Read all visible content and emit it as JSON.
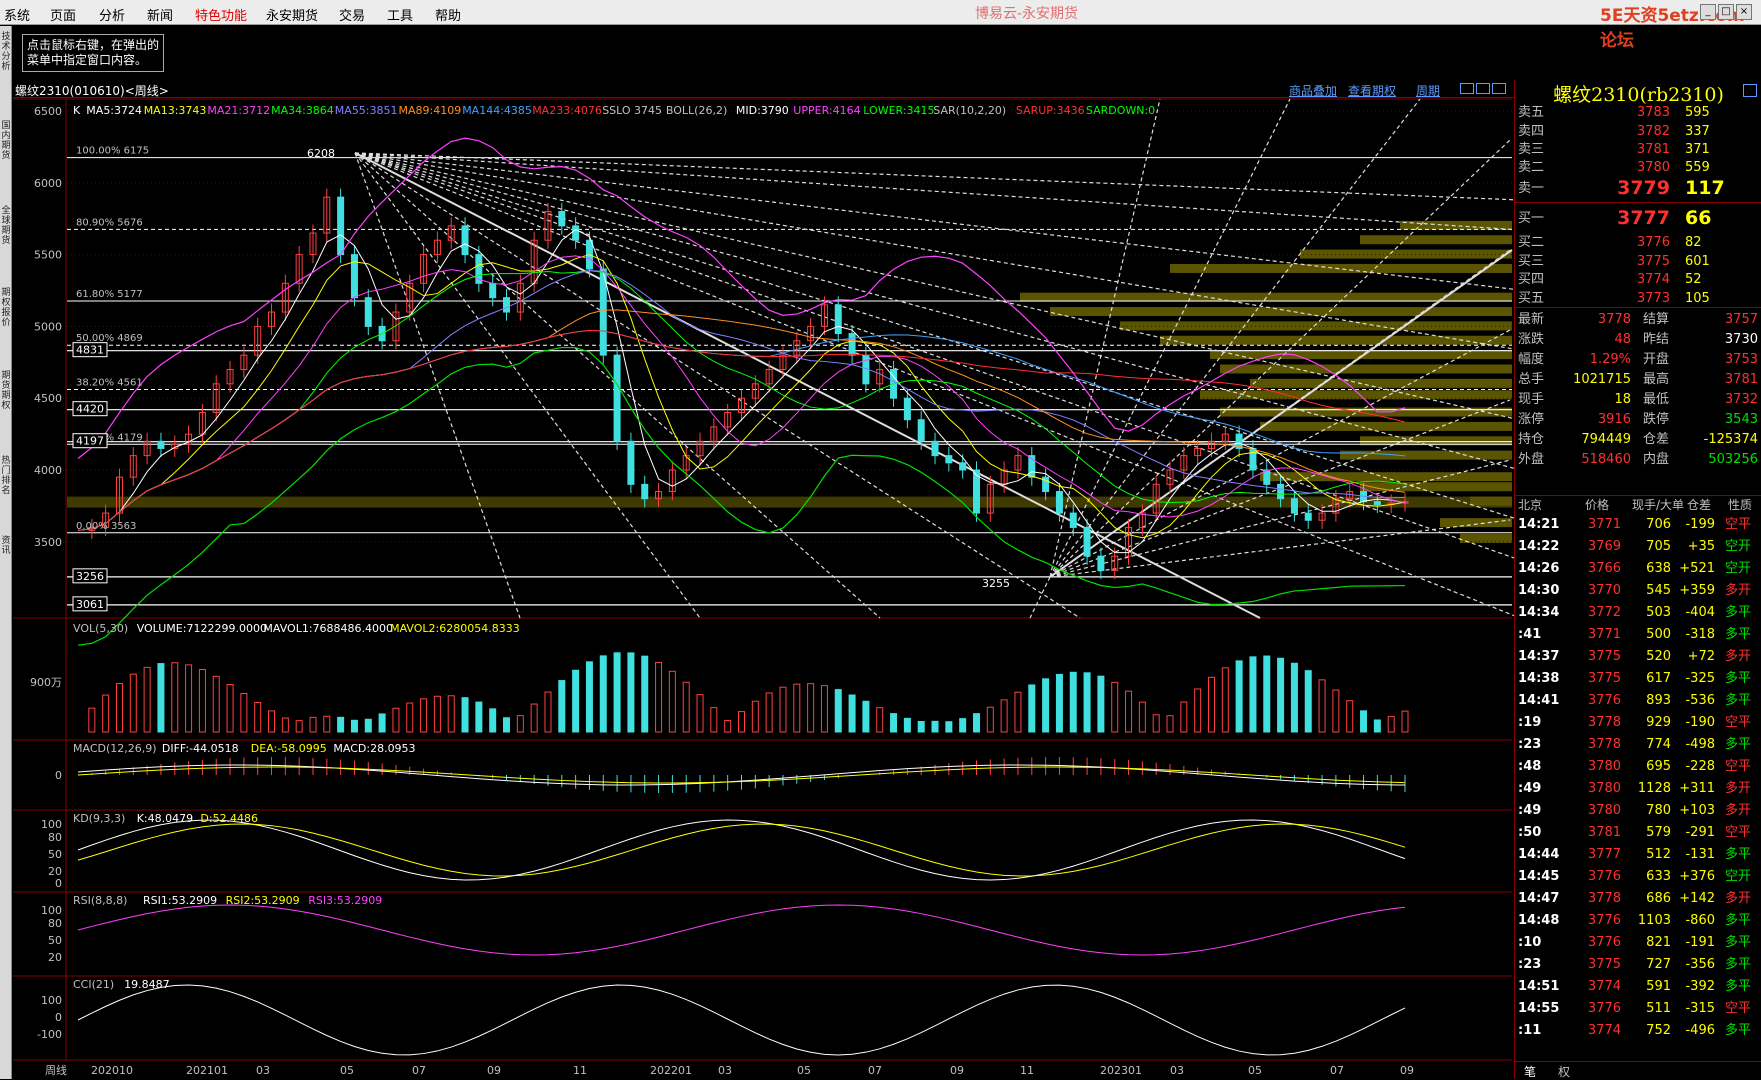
{
  "menu": {
    "items": [
      "系统",
      "页面",
      "分析",
      "新闻",
      "特色功能",
      "永安期货",
      "交易",
      "工具",
      "帮助"
    ],
    "highlight_index": 4,
    "app_title": "博易云-永安期货",
    "watermark": "5E天资5etz.com论坛",
    "window_buttons": [
      "_",
      "□",
      "×"
    ]
  },
  "left_sidebar_tabs": [
    "技术分析",
    "国内期货",
    "全球期货",
    "期权报价",
    "期货期权",
    "热门排名",
    "资讯"
  ],
  "tooltip": {
    "line1": "点击鼠标右键，在弹出的",
    "line2": "菜单中指定窗口内容。"
  },
  "symbol_bar": {
    "title": "螺纹2310(010610)<周线>",
    "link1": "商品叠加",
    "link2": "查看期权",
    "link3": "周期"
  },
  "main_header": [
    {
      "t": "K",
      "c": "#ffffff"
    },
    {
      "t": "MA5:3724",
      "c": "#ffffff"
    },
    {
      "t": "MA13:3743",
      "c": "#ffff00"
    },
    {
      "t": "MA21:3712",
      "c": "#ff40ff"
    },
    {
      "t": "MA34:3864",
      "c": "#00ff00"
    },
    {
      "t": "MA55:3851",
      "c": "#8080ff"
    },
    {
      "t": "MA89:4109",
      "c": "#ff9020"
    },
    {
      "t": "MA144:4385",
      "c": "#40a0ff"
    },
    {
      "t": "MA233:4076",
      "c": "#ff3030"
    },
    {
      "t": "SSLO 3745",
      "c": "#c0c0c0"
    },
    {
      "t": "BOLL(26,2)",
      "c": "#c0c0c0"
    },
    {
      "t": "MID:3790",
      "c": "#ffffff"
    },
    {
      "t": "UPPER:4164",
      "c": "#ff40ff"
    },
    {
      "t": "LOWER:3415",
      "c": "#00ff00"
    },
    {
      "t": "SAR(10,2,20)",
      "c": "#c0c0c0"
    },
    {
      "t": "SARUP:3436",
      "c": "#ff3030"
    },
    {
      "t": "SARDOWN:0",
      "c": "#00ff00"
    }
  ],
  "price_axis": [
    "6500",
    "6000",
    "5500",
    "5000",
    "4500",
    "4000",
    "3500"
  ],
  "fib_labels": [
    "100.00% 6175",
    "80.90% 5676",
    "61.80% 5177",
    "50.00% 4869",
    "38.20% 4561",
    "23.60% 4179",
    "0.00% 3563"
  ],
  "box_levels": [
    "4831",
    "4420",
    "4197",
    "3256",
    "3061"
  ],
  "peak_label": "6208",
  "low_label": "3255",
  "vol_header": [
    {
      "t": "VOL(5,30)",
      "c": "#c0c0c0"
    },
    {
      "t": "VOLUME:7122299.0000",
      "c": "#ffffff"
    },
    {
      "t": "MAVOL1:7688486.4000",
      "c": "#ffffff"
    },
    {
      "t": "MAVOL2:6280054.8333",
      "c": "#ffff00"
    }
  ],
  "vol_axis": "900万",
  "macd_header": [
    {
      "t": "MACD(12,26,9)",
      "c": "#c0c0c0"
    },
    {
      "t": "DIFF:-44.0518",
      "c": "#ffffff"
    },
    {
      "t": "DEA:-58.0995",
      "c": "#ffff00"
    },
    {
      "t": "MACD:28.0953",
      "c": "#ffffff"
    }
  ],
  "macd_axis": "0",
  "kd_header": [
    {
      "t": "KD(9,3,3)",
      "c": "#c0c0c0"
    },
    {
      "t": "K:48.0479",
      "c": "#ffffff"
    },
    {
      "t": "D:52.4486",
      "c": "#ffff00"
    }
  ],
  "kd_axis": [
    "100",
    "80",
    "50",
    "20",
    "0"
  ],
  "rsi_header": [
    {
      "t": "RSI(8,8,8)",
      "c": "#c0c0c0"
    },
    {
      "t": "RSI1:53.2909",
      "c": "#ffffff"
    },
    {
      "t": "RSI2:53.2909",
      "c": "#ffff00"
    },
    {
      "t": "RSI3:53.2909",
      "c": "#ff40ff"
    }
  ],
  "rsi_axis": [
    "100",
    "80",
    "50",
    "20"
  ],
  "cci_header": [
    {
      "t": "CCI(21)",
      "c": "#c0c0c0"
    },
    {
      "t": "19.8487",
      "c": "#ffffff"
    }
  ],
  "cci_axis": [
    "100",
    "0",
    "-100"
  ],
  "x_axis": [
    "周线",
    "202010",
    "202101",
    "03",
    "05",
    "07",
    "09",
    "11",
    "202201",
    "03",
    "05",
    "07",
    "09",
    "11",
    "202301",
    "03",
    "05",
    "07",
    "09"
  ],
  "quote": {
    "title": "螺纹2310(rb2310)",
    "asks": [
      {
        "label": "卖五",
        "price": "3783",
        "vol": "595"
      },
      {
        "label": "卖四",
        "price": "3782",
        "vol": "337"
      },
      {
        "label": "卖三",
        "price": "3781",
        "vol": "371"
      },
      {
        "label": "卖二",
        "price": "3780",
        "vol": "559"
      },
      {
        "label": "卖一",
        "price": "3779",
        "vol": "117"
      }
    ],
    "bids": [
      {
        "label": "买一",
        "price": "3777",
        "vol": "66"
      },
      {
        "label": "买二",
        "price": "3776",
        "vol": "82"
      },
      {
        "label": "买三",
        "price": "3775",
        "vol": "601"
      },
      {
        "label": "买四",
        "price": "3774",
        "vol": "52"
      },
      {
        "label": "买五",
        "price": "3773",
        "vol": "105"
      }
    ],
    "stats": [
      {
        "l1": "最新",
        "v1": "3778",
        "c1": "red",
        "l2": "结算",
        "v2": "3757",
        "c2": "red"
      },
      {
        "l1": "涨跌",
        "v1": "48",
        "c1": "red",
        "l2": "昨结",
        "v2": "3730",
        "c2": "wht"
      },
      {
        "l1": "幅度",
        "v1": "1.29%",
        "c1": "red",
        "l2": "开盘",
        "v2": "3753",
        "c2": "red"
      },
      {
        "l1": "总手",
        "v1": "1021715",
        "c1": "yel",
        "l2": "最高",
        "v2": "3781",
        "c2": "red"
      },
      {
        "l1": "现手",
        "v1": "18",
        "c1": "yel",
        "l2": "最低",
        "v2": "3732",
        "c2": "red"
      },
      {
        "l1": "涨停",
        "v1": "3916",
        "c1": "red",
        "l2": "跌停",
        "v2": "3543",
        "c2": "grn"
      },
      {
        "l1": "持仓",
        "v1": "794449",
        "c1": "yel",
        "l2": "仓差",
        "v2": "-125374",
        "c2": "yel"
      },
      {
        "l1": "外盘",
        "v1": "518460",
        "c1": "red",
        "l2": "内盘",
        "v2": "503256",
        "c2": "grn"
      }
    ],
    "tick_header": {
      "c1": "北京",
      "c2": "价格",
      "c3": "现手/大单",
      "c4": "仓差",
      "c5": "性质"
    },
    "ticks": [
      {
        "t": "14:21",
        "p": "3771",
        "v": "706",
        "d": "-199",
        "n": "空平",
        "nc": "red"
      },
      {
        "t": "14:22",
        "p": "3769",
        "v": "705",
        "d": "+35",
        "n": "空开",
        "nc": "grn"
      },
      {
        "t": "14:26",
        "p": "3766",
        "v": "638",
        "d": "+521",
        "n": "空开",
        "nc": "grn"
      },
      {
        "t": "14:30",
        "p": "3770",
        "v": "545",
        "d": "+359",
        "n": "多开",
        "nc": "red"
      },
      {
        "t": "14:34",
        "p": "3772",
        "v": "503",
        "d": "-404",
        "n": "多平",
        "nc": "grn"
      },
      {
        "t": ":41",
        "p": "3771",
        "v": "500",
        "d": "-318",
        "n": "多平",
        "nc": "grn"
      },
      {
        "t": "14:37",
        "p": "3775",
        "v": "520",
        "d": "+72",
        "n": "多开",
        "nc": "red"
      },
      {
        "t": "14:38",
        "p": "3775",
        "v": "617",
        "d": "-325",
        "n": "多平",
        "nc": "grn"
      },
      {
        "t": "14:41",
        "p": "3776",
        "v": "893",
        "d": "-536",
        "n": "多平",
        "nc": "grn"
      },
      {
        "t": ":19",
        "p": "3778",
        "v": "929",
        "d": "-190",
        "n": "空平",
        "nc": "red"
      },
      {
        "t": ":23",
        "p": "3778",
        "v": "774",
        "d": "-498",
        "n": "多平",
        "nc": "grn"
      },
      {
        "t": ":48",
        "p": "3780",
        "v": "695",
        "d": "-228",
        "n": "空平",
        "nc": "red"
      },
      {
        "t": ":49",
        "p": "3780",
        "v": "1128",
        "d": "+311",
        "n": "多开",
        "nc": "red"
      },
      {
        "t": ":49",
        "p": "3780",
        "v": "780",
        "d": "+103",
        "n": "多开",
        "nc": "red"
      },
      {
        "t": ":50",
        "p": "3781",
        "v": "579",
        "d": "-291",
        "n": "空平",
        "nc": "red"
      },
      {
        "t": "14:44",
        "p": "3777",
        "v": "512",
        "d": "-131",
        "n": "多平",
        "nc": "grn"
      },
      {
        "t": "14:45",
        "p": "3776",
        "v": "633",
        "d": "+376",
        "n": "空开",
        "nc": "grn"
      },
      {
        "t": "14:47",
        "p": "3778",
        "v": "686",
        "d": "+142",
        "n": "多开",
        "nc": "red"
      },
      {
        "t": "14:48",
        "p": "3776",
        "v": "1103",
        "d": "-860",
        "n": "多平",
        "nc": "grn"
      },
      {
        "t": ":10",
        "p": "3776",
        "v": "821",
        "d": "-191",
        "n": "多平",
        "nc": "grn"
      },
      {
        "t": ":23",
        "p": "3775",
        "v": "727",
        "d": "-356",
        "n": "多平",
        "nc": "grn"
      },
      {
        "t": "14:51",
        "p": "3774",
        "v": "591",
        "d": "-392",
        "n": "多平",
        "nc": "grn"
      },
      {
        "t": "14:55",
        "p": "3776",
        "v": "511",
        "d": "-315",
        "n": "空平",
        "nc": "red"
      },
      {
        "t": ":11",
        "p": "3774",
        "v": "752",
        "d": "-496",
        "n": "多平",
        "nc": "grn"
      }
    ],
    "bottom_tabs": [
      "笔",
      "权"
    ]
  }
}
